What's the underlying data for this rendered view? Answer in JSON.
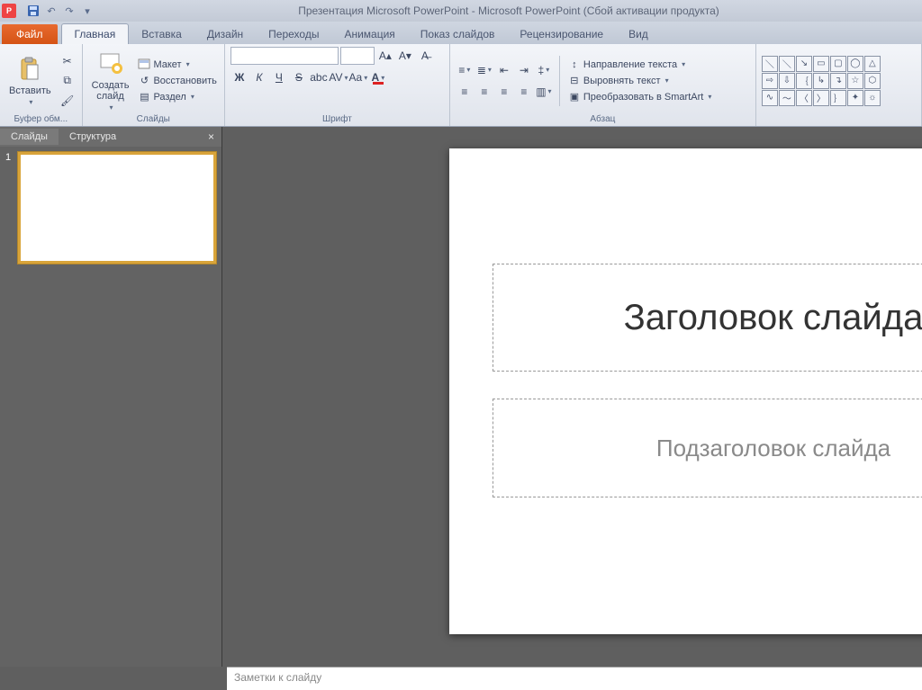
{
  "title": "Презентация Microsoft PowerPoint - Microsoft PowerPoint (Сбой активации продукта)",
  "file_tab": "Файл",
  "tabs": [
    "Главная",
    "Вставка",
    "Дизайн",
    "Переходы",
    "Анимация",
    "Показ слайдов",
    "Рецензирование",
    "Вид"
  ],
  "active_tab_index": 0,
  "ribbon": {
    "clipboard": {
      "paste": "Вставить",
      "label": "Буфер обм..."
    },
    "slides": {
      "new": "Создать\nслайд",
      "layout": "Макет",
      "reset": "Восстановить",
      "section": "Раздел",
      "label": "Слайды"
    },
    "font": {
      "font_name": "",
      "font_size": "",
      "label": "Шрифт"
    },
    "paragraph": {
      "label": "Абзац",
      "text_direction": "Направление текста",
      "align_text": "Выровнять текст",
      "convert_smartart": "Преобразовать в SmartArt"
    }
  },
  "left_panel": {
    "tabs": [
      "Слайды",
      "Структура"
    ],
    "active_index": 0,
    "slide_number": "1"
  },
  "slide": {
    "title_placeholder": "Заголовок слайда",
    "subtitle_placeholder": "Подзаголовок слайда"
  },
  "notes_placeholder": "Заметки к слайду"
}
